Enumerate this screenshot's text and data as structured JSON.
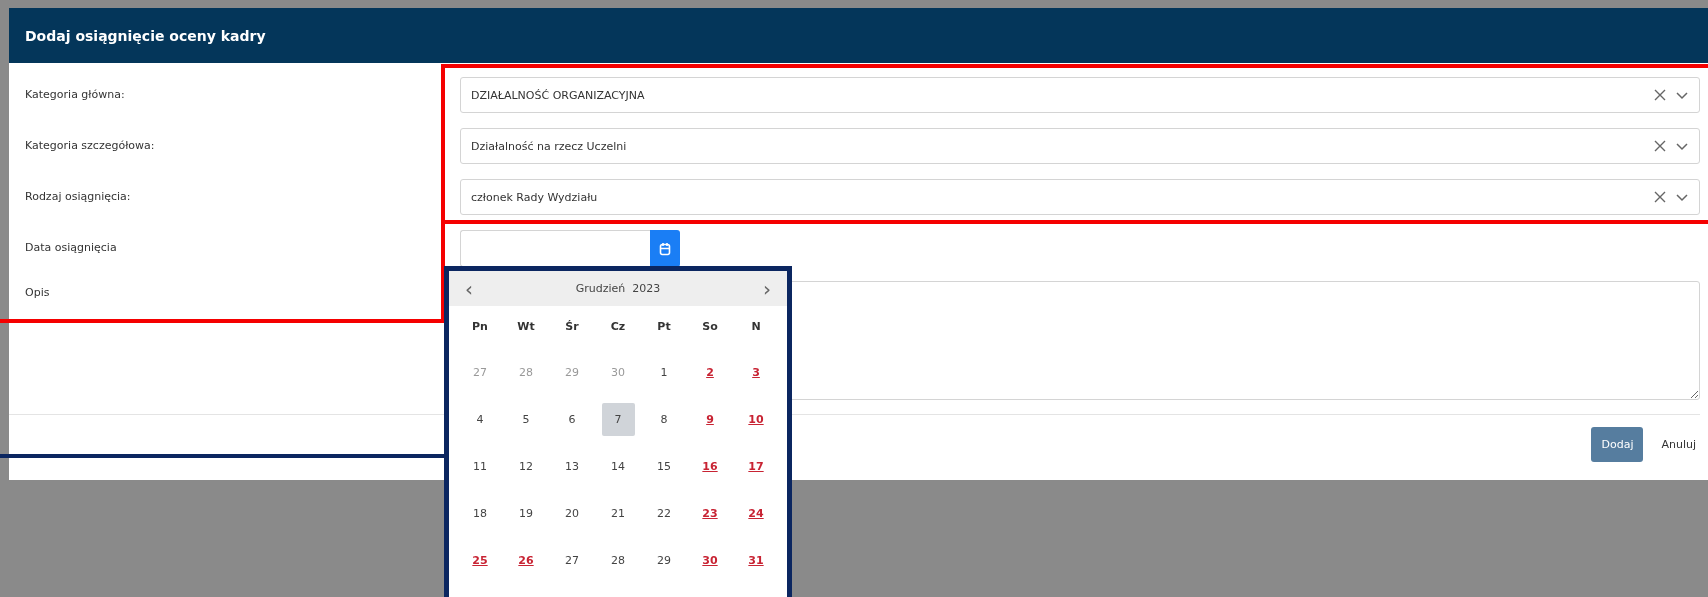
{
  "dialog": {
    "title": "Dodaj osiągnięcie oceny kadry"
  },
  "fields": [
    {
      "label": "Kategoria główna:",
      "kind": "select",
      "value": "DZIAŁALNOŚĆ ORGANIZACYJNA"
    },
    {
      "label": "Kategoria szczegółowa:",
      "kind": "select",
      "value": "Działalność na rzecz Uczelni"
    },
    {
      "label": "Rodzaj osiągnięcia:",
      "kind": "select",
      "value": "członek Rady Wydziału"
    },
    {
      "label": "Data osiągnięcia",
      "kind": "date"
    },
    {
      "label": "Opis",
      "kind": "textarea"
    }
  ],
  "datepicker": {
    "prev": "‹",
    "title": "Grudzień  2023",
    "next": "›",
    "weekdays": [
      "Pn",
      "Wt",
      "Śr",
      "Cz",
      "Pt",
      "So",
      "N"
    ],
    "weeks": [
      [
        {
          "day": "27",
          "outside": true,
          "holiday": false,
          "selected": false
        },
        {
          "day": "28",
          "outside": true,
          "holiday": false,
          "selected": false
        },
        {
          "day": "29",
          "outside": true,
          "holiday": false,
          "selected": false
        },
        {
          "day": "30",
          "outside": true,
          "holiday": false,
          "selected": false
        },
        {
          "day": "1",
          "outside": false,
          "holiday": false,
          "selected": false
        },
        {
          "day": "2",
          "outside": false,
          "holiday": true,
          "selected": false
        },
        {
          "day": "3",
          "outside": false,
          "holiday": true,
          "selected": false
        }
      ],
      [
        {
          "day": "4",
          "outside": false,
          "holiday": false,
          "selected": false
        },
        {
          "day": "5",
          "outside": false,
          "holiday": false,
          "selected": false
        },
        {
          "day": "6",
          "outside": false,
          "holiday": false,
          "selected": false
        },
        {
          "day": "7",
          "outside": false,
          "holiday": false,
          "selected": true
        },
        {
          "day": "8",
          "outside": false,
          "holiday": false,
          "selected": false
        },
        {
          "day": "9",
          "outside": false,
          "holiday": true,
          "selected": false
        },
        {
          "day": "10",
          "outside": false,
          "holiday": true,
          "selected": false
        }
      ],
      [
        {
          "day": "11",
          "outside": false,
          "holiday": false,
          "selected": false
        },
        {
          "day": "12",
          "outside": false,
          "holiday": false,
          "selected": false
        },
        {
          "day": "13",
          "outside": false,
          "holiday": false,
          "selected": false
        },
        {
          "day": "14",
          "outside": false,
          "holiday": false,
          "selected": false
        },
        {
          "day": "15",
          "outside": false,
          "holiday": false,
          "selected": false
        },
        {
          "day": "16",
          "outside": false,
          "holiday": true,
          "selected": false
        },
        {
          "day": "17",
          "outside": false,
          "holiday": true,
          "selected": false
        }
      ],
      [
        {
          "day": "18",
          "outside": false,
          "holiday": false,
          "selected": false
        },
        {
          "day": "19",
          "outside": false,
          "holiday": false,
          "selected": false
        },
        {
          "day": "20",
          "outside": false,
          "holiday": false,
          "selected": false
        },
        {
          "day": "21",
          "outside": false,
          "holiday": false,
          "selected": false
        },
        {
          "day": "22",
          "outside": false,
          "holiday": false,
          "selected": false
        },
        {
          "day": "23",
          "outside": false,
          "holiday": true,
          "selected": false
        },
        {
          "day": "24",
          "outside": false,
          "holiday": true,
          "selected": false
        }
      ],
      [
        {
          "day": "25",
          "outside": false,
          "holiday": true,
          "selected": false
        },
        {
          "day": "26",
          "outside": false,
          "holiday": true,
          "selected": false
        },
        {
          "day": "27",
          "outside": false,
          "holiday": false,
          "selected": false
        },
        {
          "day": "28",
          "outside": false,
          "holiday": false,
          "selected": false
        },
        {
          "day": "29",
          "outside": false,
          "holiday": false,
          "selected": false
        },
        {
          "day": "30",
          "outside": false,
          "holiday": true,
          "selected": false
        },
        {
          "day": "31",
          "outside": false,
          "holiday": true,
          "selected": false
        }
      ]
    ]
  },
  "buttons": [
    {
      "label": "Dodaj",
      "kind": "primary"
    },
    {
      "label": "Anuluj",
      "kind": "link"
    }
  ]
}
